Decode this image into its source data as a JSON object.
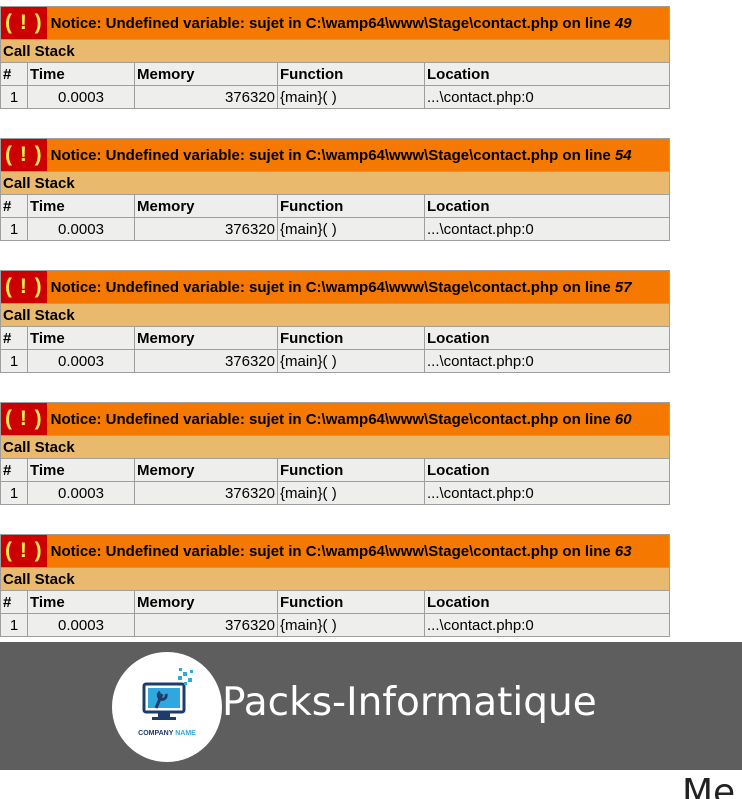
{
  "notices": [
    {
      "bang": "( ! )",
      "message": "Notice: Undefined variable: sujet in C:\\wamp64\\www\\Stage\\contact.php on line ",
      "line": "49",
      "call_stack_label": "Call Stack",
      "headers": [
        "#",
        "Time",
        "Memory",
        "Function",
        "Location"
      ],
      "row": [
        "1",
        "0.0003",
        "376320",
        "{main}( )",
        "...\\contact.php:0"
      ]
    },
    {
      "bang": "( ! )",
      "message": "Notice: Undefined variable: sujet in C:\\wamp64\\www\\Stage\\contact.php on line ",
      "line": "54",
      "call_stack_label": "Call Stack",
      "headers": [
        "#",
        "Time",
        "Memory",
        "Function",
        "Location"
      ],
      "row": [
        "1",
        "0.0003",
        "376320",
        "{main}( )",
        "...\\contact.php:0"
      ]
    },
    {
      "bang": "( ! )",
      "message": "Notice: Undefined variable: sujet in C:\\wamp64\\www\\Stage\\contact.php on line ",
      "line": "57",
      "call_stack_label": "Call Stack",
      "headers": [
        "#",
        "Time",
        "Memory",
        "Function",
        "Location"
      ],
      "row": [
        "1",
        "0.0003",
        "376320",
        "{main}( )",
        "...\\contact.php:0"
      ]
    },
    {
      "bang": "( ! )",
      "message": "Notice: Undefined variable: sujet in C:\\wamp64\\www\\Stage\\contact.php on line ",
      "line": "60",
      "call_stack_label": "Call Stack",
      "headers": [
        "#",
        "Time",
        "Memory",
        "Function",
        "Location"
      ],
      "row": [
        "1",
        "0.0003",
        "376320",
        "{main}( )",
        "...\\contact.php:0"
      ]
    },
    {
      "bang": "( ! )",
      "message": "Notice: Undefined variable: sujet in C:\\wamp64\\www\\Stage\\contact.php on line ",
      "line": "63",
      "call_stack_label": "Call Stack",
      "headers": [
        "#",
        "Time",
        "Memory",
        "Function",
        "Location"
      ],
      "row": [
        "1",
        "0.0003",
        "376320",
        "{main}( )",
        "...\\contact.php:0"
      ]
    }
  ],
  "header": {
    "logo": {
      "icon": "computer-repair-icon",
      "company_word": "COMPANY",
      "name_word": "NAME"
    },
    "brand_name": "Packs-Informatique"
  },
  "partial_text": "Me",
  "colors": {
    "notice_orange": "#f57900",
    "bang_red": "#cc0000",
    "bang_yellow": "#fce94f",
    "callstack_tan": "#e9b96e",
    "row_grey": "#eeeeec",
    "header_bar": "#5e5e5e"
  }
}
